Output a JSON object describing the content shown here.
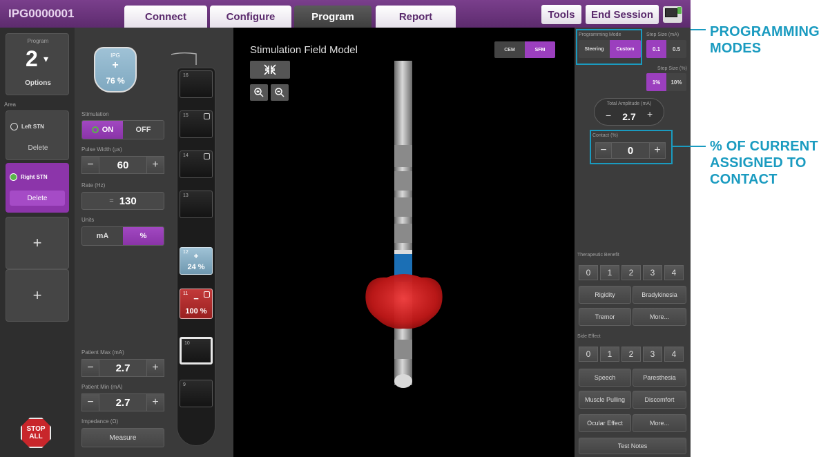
{
  "header": {
    "device_id": "IPG0000001",
    "tabs": [
      {
        "label": "Connect",
        "active": false
      },
      {
        "label": "Configure",
        "active": false
      },
      {
        "label": "Program",
        "active": true
      },
      {
        "label": "Report",
        "active": false
      }
    ],
    "tools_label": "Tools",
    "end_session_label": "End Session"
  },
  "left": {
    "program_label": "Program",
    "program_number": "2",
    "program_caret": "▾",
    "options_label": "Options",
    "area_label": "Area",
    "areas": [
      {
        "label": "Left STN",
        "delete_label": "Delete",
        "selected": false
      },
      {
        "label": "Right STN",
        "delete_label": "Delete",
        "selected": true
      }
    ],
    "add_label": "+",
    "stop_line1": "STOP",
    "stop_line2": "ALL"
  },
  "settings": {
    "ipg_label": "IPG",
    "ipg_sign": "+",
    "ipg_percent": "76 %",
    "stimulation_label": "Stimulation",
    "on_label": "ON",
    "off_label": "OFF",
    "pulse_width_label": "Pulse Width (µs)",
    "pulse_width_value": "60",
    "rate_label": "Rate (Hz)",
    "rate_value": "130",
    "rate_prefix": "=",
    "units_label": "Units",
    "unit_ma": "mA",
    "unit_pct": "%",
    "patient_max_label": "Patient Max (mA)",
    "patient_max_value": "2.7",
    "patient_min_label": "Patient Min (mA)",
    "patient_min_value": "2.7",
    "impedance_label": "Impedance (Ω)",
    "measure_label": "Measure",
    "minus": "−",
    "plus": "+"
  },
  "lead": {
    "contacts": [
      {
        "num": "16",
        "state": "off",
        "label": ""
      },
      {
        "num": "15",
        "state": "off",
        "label": ""
      },
      {
        "num": "14",
        "state": "off",
        "label": ""
      },
      {
        "num": "13",
        "state": "off",
        "label": ""
      },
      {
        "num": "12",
        "state": "anode",
        "sign": "+",
        "label": "24 %"
      },
      {
        "num": "11",
        "state": "cathode",
        "sign": "−",
        "label": "100 %"
      },
      {
        "num": "10",
        "state": "selected",
        "label": ""
      },
      {
        "num": "9",
        "state": "off",
        "label": ""
      }
    ]
  },
  "viewport": {
    "title": "Stimulation Field Model",
    "mode_cem": "CEM",
    "mode_sfm": "SFM",
    "collapse_icon": "collapse-arrows-icon",
    "zoom_in_icon": "zoom-in-icon",
    "zoom_out_icon": "zoom-out-icon"
  },
  "right": {
    "programming_mode_label": "Programming Mode",
    "steering_label": "Steering",
    "custom_label": "Custom",
    "step_ma_label": "Step Size (mA)",
    "step_ma_options": [
      "0.1",
      "0.5"
    ],
    "step_pct_label": "Step Size (%)",
    "step_pct_options": [
      "1%",
      "10%"
    ],
    "total_amp_label": "Total Amplitude (mA)",
    "total_amp_value": "2.7",
    "contact_label": "Contact (%)",
    "contact_value": "0",
    "therapeutic_label": "Therapeutic Benefit",
    "scores": [
      "0",
      "1",
      "2",
      "3",
      "4"
    ],
    "benefit_items": [
      "Rigidity",
      "Bradykinesia",
      "Tremor",
      "More..."
    ],
    "side_effect_label": "Side Effect",
    "side_items": [
      "Speech",
      "Paresthesia",
      "Muscle Pulling",
      "Discomfort",
      "Ocular Effect",
      "More..."
    ],
    "test_notes_label": "Test Notes"
  },
  "annotations": {
    "programming_modes": [
      "PROGRAMMING",
      "MODES"
    ],
    "contact_percent": [
      "% OF CURRENT",
      "ASSIGNED TO",
      "CONTACT"
    ],
    "color": "#1a9bc0"
  },
  "colors": {
    "brand_purple": "#7a3f8c",
    "accent_purple": "#9b3fbe",
    "on_green": "#5ab44b",
    "anode_blue": "#7fa8c0",
    "cathode_red": "#b22a2a",
    "field_red": "#c62020",
    "active_blue": "#1b6fb5"
  }
}
